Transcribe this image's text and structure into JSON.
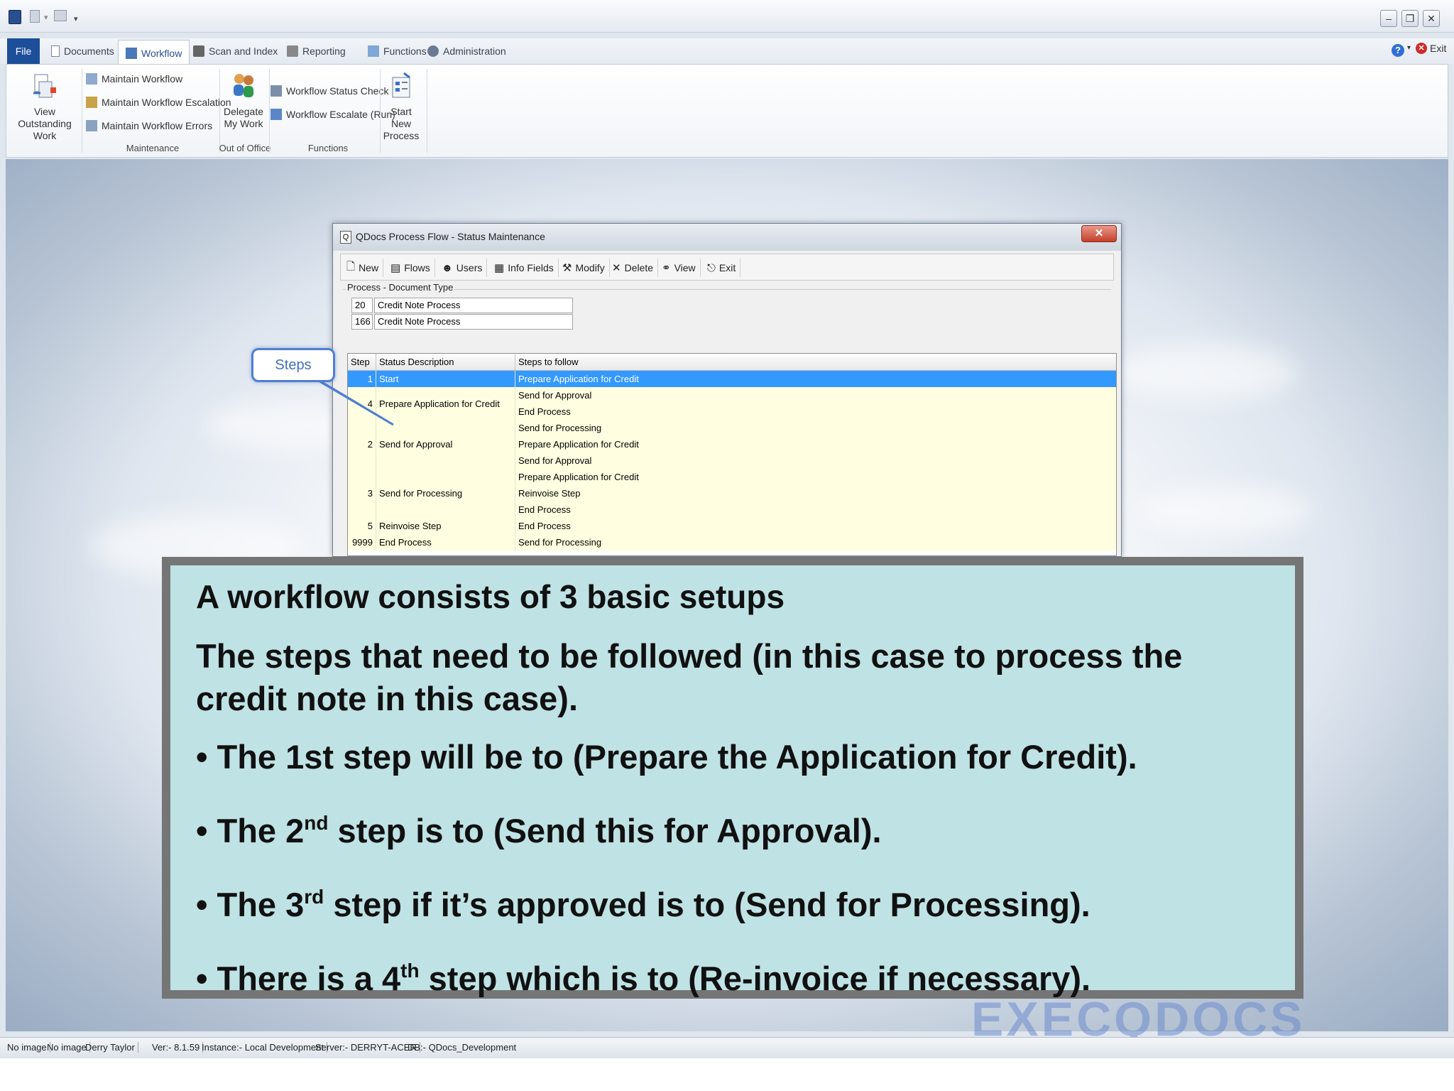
{
  "tabs": {
    "file": "File",
    "documents": "Documents",
    "workflow": "Workflow",
    "scan": "Scan and Index",
    "reporting": "Reporting",
    "functions": "Functions",
    "admin": "Administration"
  },
  "exit_label": "Exit",
  "ribbon": {
    "view_outstanding": "View Outstanding Work",
    "maintain_workflow": "Maintain Workflow",
    "maintain_escalation": "Maintain Workflow  Escalation",
    "maintain_errors": "Maintain Workflow Errors",
    "delegate": "Delegate My Work",
    "status_check": "Workflow Status Check",
    "escalate_run": "Workflow Escalate (Run)",
    "start_new": "Start New Process",
    "group_maintenance": "Maintenance",
    "group_out_of_office": "Out of Office",
    "group_functions": "Functions"
  },
  "dialog": {
    "title": "QDocs Process Flow - Status Maintenance",
    "toolbar": [
      "New",
      "Flows",
      "Users",
      "Info Fields",
      "Modify",
      "Delete",
      "View",
      "Exit"
    ],
    "process_group_label": "Process - Document Type",
    "process": {
      "id": "20",
      "name": "Credit Note Process"
    },
    "doc_type": {
      "id": "166",
      "name": "Credit Note Process"
    },
    "grid_headers": [
      "Step",
      "Status Description",
      "Steps to follow"
    ],
    "rows": [
      {
        "step": "1",
        "desc": "Start",
        "next": [
          "Prepare Application for Credit"
        ]
      },
      {
        "step": "4",
        "desc": "Prepare Application for Credit",
        "next": [
          "Send for Approval",
          "End Process"
        ]
      },
      {
        "step": "2",
        "desc": "Send for Approval",
        "next": [
          "Send for Processing",
          "Prepare Application for Credit",
          "Send for Approval"
        ]
      },
      {
        "step": "3",
        "desc": "Send for Processing",
        "next": [
          "Prepare Application for Credit",
          "Reinvoise Step",
          "End Process"
        ]
      },
      {
        "step": "5",
        "desc": "Reinvoise Step",
        "next": [
          "End Process"
        ]
      },
      {
        "step": "9999",
        "desc": "End Process",
        "next": [
          "Send for Processing"
        ]
      }
    ]
  },
  "callout": "Steps",
  "note": {
    "heading": "A workflow consists of 3 basic setups",
    "intro": "The steps that need to be followed (in this case to process the credit note in this case).",
    "bullets": [
      {
        "pre": "The 1st step will be to (Prepare the Application for Credit).",
        "sup": "",
        "post": ""
      },
      {
        "pre": "The 2",
        "sup": "nd",
        "post": " step is to (Send this for Approval)."
      },
      {
        "pre": "The 3",
        "sup": "rd",
        "post": " step if it’s approved is to (Send for Processing)."
      },
      {
        "pre": "There is a 4",
        "sup": "th",
        "post": " step which is to (Re-invoice if necessary)."
      }
    ]
  },
  "watermark": "EXECQDOCS",
  "status": {
    "img1": "No image",
    "img2": "No image",
    "user": "Derry Taylor",
    "version": "Ver:- 8.1.59",
    "instance": "Instance:- Local Development",
    "server": "Server:- DERRYT-ACER",
    "db": "DB:- QDocs_Development"
  },
  "colors": {
    "selection": "#3399ff",
    "row_bg": "#fffee0",
    "note_bg": "#bfe2e5",
    "file_tab": "#1d4e99"
  }
}
